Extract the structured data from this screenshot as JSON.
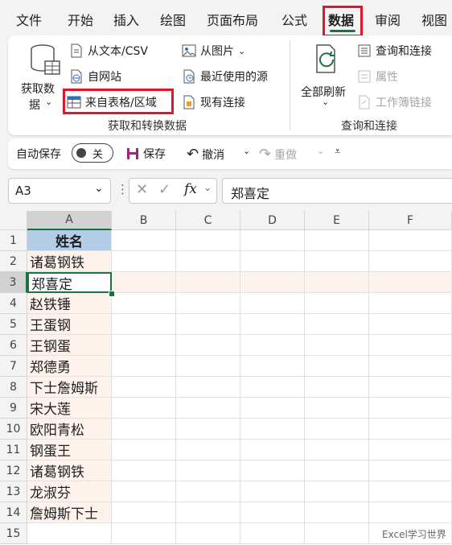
{
  "tabs": [
    {
      "label": "文件"
    },
    {
      "label": "开始"
    },
    {
      "label": "插入"
    },
    {
      "label": "绘图"
    },
    {
      "label": "页面布局"
    },
    {
      "label": "公式"
    },
    {
      "label": "数据"
    },
    {
      "label": "审阅"
    },
    {
      "label": "视图"
    }
  ],
  "ribbon": {
    "get_data": {
      "line1": "获取数",
      "line2": "据"
    },
    "from_text": "从文本/CSV",
    "from_web": "自网站",
    "from_table": "来自表格/区域",
    "from_picture": "从图片",
    "recent_sources": "最近使用的源",
    "existing_connections": "现有连接",
    "group1_label": "获取和转换数据",
    "refresh_all": "全部刷新",
    "queries_connections": "查询和连接",
    "properties": "属性",
    "workbook_links": "工作簿链接",
    "group2_label": "查询和连接"
  },
  "qat": {
    "autosave": "自动保存",
    "toggle": "关",
    "save": "保存",
    "undo": "撤消",
    "redo": "重做"
  },
  "formula_bar": {
    "name_box": "A3",
    "fx": "fx",
    "content": "郑喜定"
  },
  "grid": {
    "columns": [
      "A",
      "B",
      "C",
      "D",
      "E",
      "F"
    ],
    "rows": [
      "1",
      "2",
      "3",
      "4",
      "5",
      "6",
      "7",
      "8",
      "9",
      "10",
      "11",
      "12",
      "13",
      "14",
      "15"
    ],
    "colA": [
      "姓名",
      "诸葛钢铁",
      "郑喜定",
      "赵铁锤",
      "王蛋钢",
      "王钢蛋",
      "郑德勇",
      "下士詹姆斯",
      "宋大莲",
      "欧阳青松",
      "钢蛋王",
      "诸葛钢铁",
      "龙淑芬",
      "詹姆斯下士",
      ""
    ]
  },
  "watermark": "Excel学习世界",
  "colors": {
    "accent_green": "#1a7343",
    "highlight_red": "#e0162b",
    "header_blue": "#b4cde6",
    "row_tint": "#fdf3ec"
  }
}
